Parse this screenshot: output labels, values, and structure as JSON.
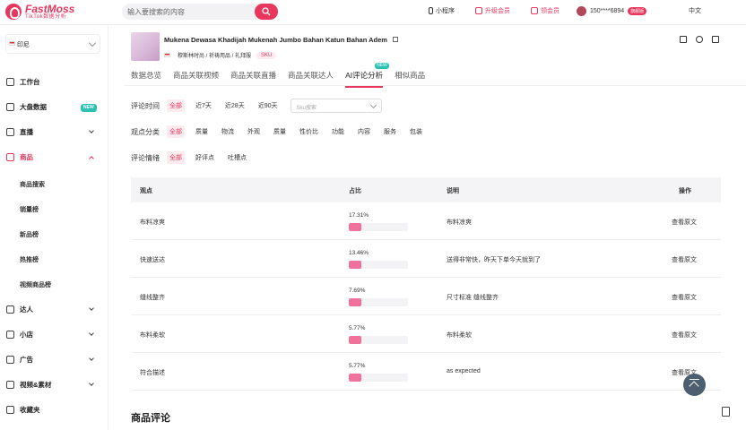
{
  "brand": {
    "name": "FastMoss",
    "sub": "TikTok数据分析"
  },
  "search": {
    "placeholder": "输入要搜索的内容"
  },
  "header": {
    "miniapp": "小程序",
    "upgrade": "升级会员",
    "earn": "领会员",
    "user": "150****6894",
    "user_badge": "旗舰版",
    "lang": "中文"
  },
  "sidebar": {
    "region": "印尼",
    "items": [
      {
        "label": "工作台",
        "icon": "home-icon"
      },
      {
        "label": "大盘数据",
        "icon": "chart-icon",
        "tag": "NEW"
      },
      {
        "label": "直播",
        "icon": "live-icon"
      },
      {
        "label": "商品",
        "icon": "bag-icon",
        "active": true
      },
      {
        "label": "达人",
        "icon": "user-icon"
      },
      {
        "label": "小店",
        "icon": "shop-icon"
      },
      {
        "label": "广告",
        "icon": "ad-icon"
      },
      {
        "label": "视频&素材",
        "icon": "video-icon"
      },
      {
        "label": "收藏夹",
        "icon": "folder-icon"
      }
    ],
    "sub_items": [
      "商品搜索",
      "销量榜",
      "新品榜",
      "热推榜",
      "视频商品榜"
    ]
  },
  "product": {
    "title": "Mukena Dewasa Khadijah Mukenah Jumbo Bahan Katun Bahan Adem",
    "category": "穆斯林时尚 / 祈祷用品 / 礼拜服",
    "sku_label": "SKU"
  },
  "tabs": [
    "数据总览",
    "商品关联视频",
    "商品关联直播",
    "商品关联达人",
    "AI评论分析",
    "相似商品"
  ],
  "tab_new": "NEW",
  "filters": {
    "time": {
      "label": "评论时间",
      "options": [
        "全部",
        "近7天",
        "近28天",
        "近90天"
      ],
      "sku_placeholder": "Sku搜索"
    },
    "view": {
      "label": "观点分类",
      "options": [
        "全部",
        "质量",
        "物流",
        "外观",
        "质量",
        "性价比",
        "功能",
        "内容",
        "服务",
        "包装"
      ]
    },
    "sentiment": {
      "label": "评论情绪",
      "options": [
        "全部",
        "好评点",
        "吐槽点"
      ]
    }
  },
  "table": {
    "headers": [
      "观点",
      "占比",
      "说明",
      "操作"
    ],
    "rows": [
      {
        "point": "布料凉爽",
        "pct": "17.31%",
        "ratio": 17.31,
        "desc": "布料凉爽",
        "action": "查看原文"
      },
      {
        "point": "快速送达",
        "pct": "13.46%",
        "ratio": 13.46,
        "desc": "送得非常快，昨天下单今天就到了",
        "action": "查看原文"
      },
      {
        "point": "缝线整齐",
        "pct": "7.69%",
        "ratio": 7.69,
        "desc": "尺寸标准 缝线整齐",
        "action": "查看原文"
      },
      {
        "point": "布料柔软",
        "pct": "5.77%",
        "ratio": 5.77,
        "desc": "布料柔软",
        "action": "查看原文"
      },
      {
        "point": "符合描述",
        "pct": "5.77%",
        "ratio": 5.77,
        "desc": "as expected",
        "action": "查看原文"
      }
    ]
  },
  "section_title": "商品评论",
  "colors": {
    "accent": "#e8365d",
    "bar": "#f0729b",
    "new_tag": "#2bc2b4"
  }
}
